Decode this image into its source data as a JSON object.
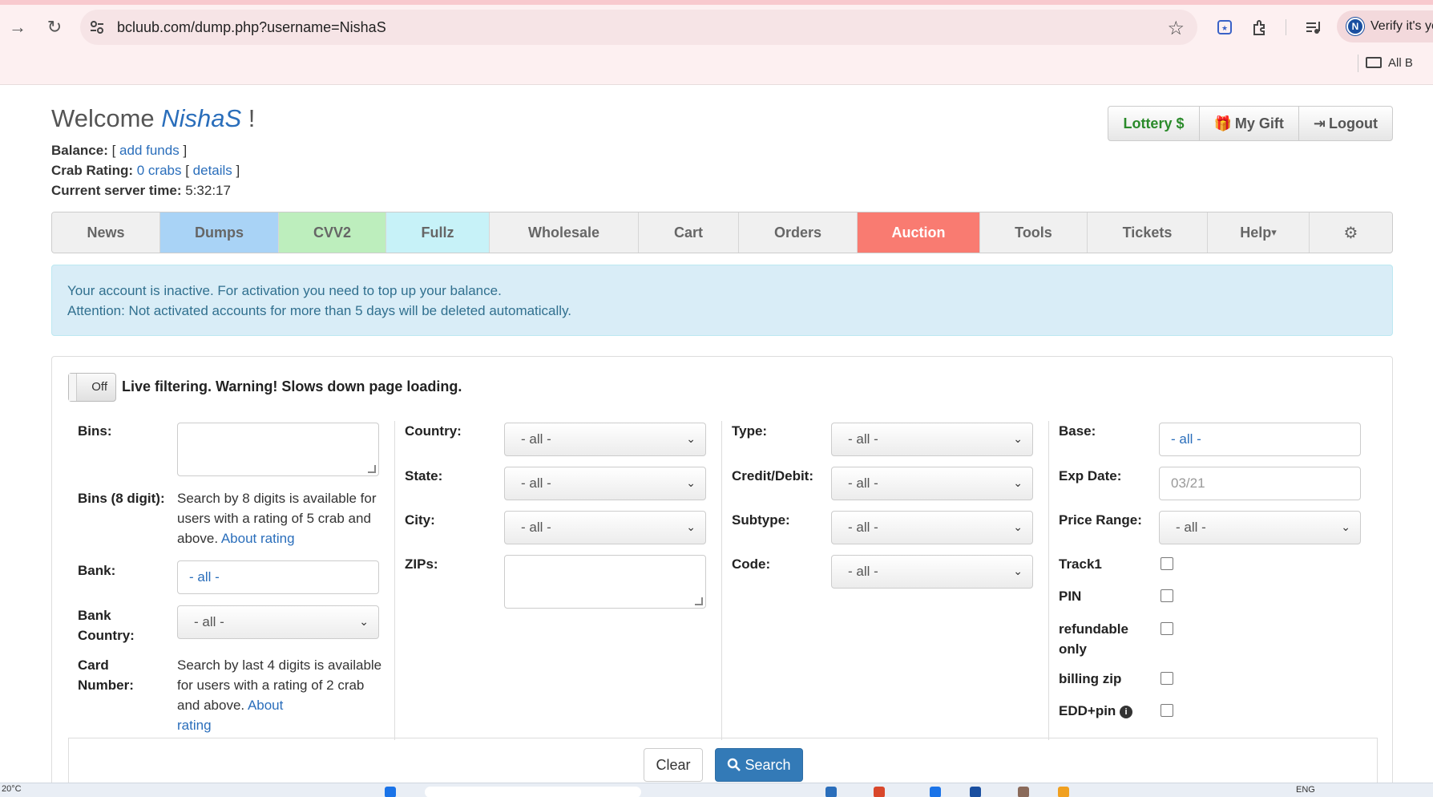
{
  "browser": {
    "url": "bcluub.com/dump.php?username=NishaS",
    "profile_text": "Verify it's yo",
    "profile_initial": "N",
    "bookmarks_label": "All B"
  },
  "header": {
    "welcome_prefix": "Welcome ",
    "username": "NishaS",
    "welcome_suffix": " !",
    "balance_label": "Balance:",
    "add_funds": "add funds",
    "crab_label": "Crab Rating:",
    "crabs": "0 crabs",
    "details": "details",
    "time_label": "Current server time:",
    "time": "5:32:17",
    "lottery": "Lottery",
    "my_gift": "My Gift",
    "logout": "Logout"
  },
  "menu": [
    {
      "label": "News",
      "color": "#f0f0f0"
    },
    {
      "label": "Dumps",
      "color": "#a9d3f6"
    },
    {
      "label": "CVV2",
      "color": "#bdeebd"
    },
    {
      "label": "Fullz",
      "color": "#c7f2f8"
    },
    {
      "label": "Wholesale",
      "color": "#f0f0f0"
    },
    {
      "label": "Cart",
      "color": "#f0f0f0"
    },
    {
      "label": "Orders",
      "color": "#f0f0f0"
    },
    {
      "label": "Auction",
      "color": "#f97b71"
    },
    {
      "label": "Tools",
      "color": "#f0f0f0"
    },
    {
      "label": "Tickets",
      "color": "#f0f0f0"
    },
    {
      "label": "Help",
      "color": "#f0f0f0"
    }
  ],
  "alert": {
    "line1": "Your account is inactive. For activation you need to top up your balance.",
    "line2": "Attention: Not activated accounts for more than 5 days will be deleted automatically."
  },
  "filters": {
    "toggle_label": "Off",
    "live_label": "Live filtering. Warning! Slows down page loading.",
    "bins": "Bins:",
    "bins8": "Bins (8 digit):",
    "bins8_hint": "Search by 8 digits is available for users with a rating of 5 crab and above.",
    "about_rating": "About rating",
    "bank": "Bank:",
    "bank_value": "- all -",
    "bank_country_1": "Bank",
    "bank_country_2": "Country:",
    "bank_country_value": "- all -",
    "card_number_1": "Card",
    "card_number_2": "Number:",
    "card_hint": "Search by last 4 digits is available for users with a rating of 2 crab and above.",
    "about": "About",
    "rating": "rating",
    "country": "Country:",
    "country_value": "- all -",
    "state": "State:",
    "state_value": "- all -",
    "city": "City:",
    "city_value": "- all -",
    "zips": "ZIPs:",
    "type": "Type:",
    "type_value": "- all -",
    "credit_debit": "Credit/Debit:",
    "credit_debit_value": "- all -",
    "subtype": "Subtype:",
    "subtype_value": "- all -",
    "code": "Code:",
    "code_value": "- all -",
    "base": "Base:",
    "base_value": "- all -",
    "exp_date": "Exp Date:",
    "exp_placeholder": "03/21",
    "price_range": "Price Range:",
    "price_value": "- all -",
    "track1": "Track1",
    "pin": "PIN",
    "refundable_1": "refundable",
    "refundable_2": "only",
    "billing_zip": "billing zip",
    "edd_pin": "EDD+pin",
    "clear": "Clear",
    "search": "Search"
  },
  "taskbar": {
    "weather": "20°C",
    "lang": "ENG"
  }
}
